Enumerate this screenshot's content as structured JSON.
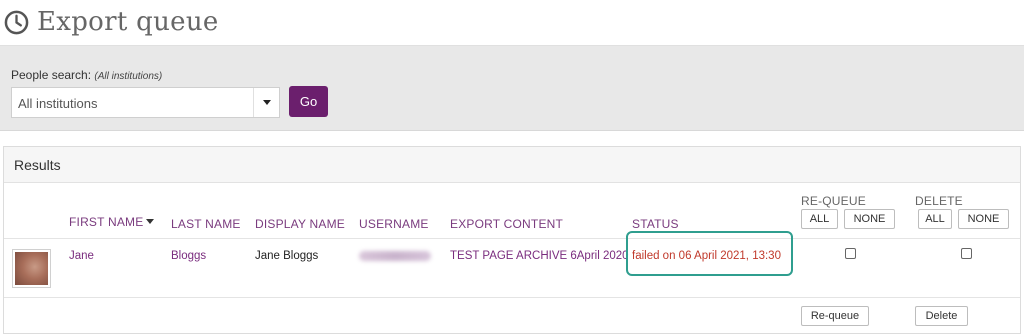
{
  "page": {
    "title": "Export queue"
  },
  "search": {
    "label": "People search:",
    "hint": "(All institutions)",
    "selected": "All institutions",
    "go_label": "Go"
  },
  "results": {
    "header": "Results",
    "columns": {
      "first_name": "FIRST NAME",
      "last_name": "LAST NAME",
      "display_name": "DISPLAY NAME",
      "username": "USERNAME",
      "export_content": "EXPORT CONTENT",
      "status": "STATUS",
      "requeue": "RE-QUEUE",
      "delete": "DELETE"
    },
    "select_buttons": {
      "all": "ALL",
      "none": "NONE"
    },
    "rows": [
      {
        "first_name": "Jane",
        "last_name": "Bloggs",
        "display_name": "Jane Bloggs",
        "export_content": "TEST PAGE ARCHIVE 6April 2020",
        "status": "failed on 06 April 2021, 13:30"
      }
    ],
    "actions": {
      "requeue": "Re-queue",
      "delete": "Delete"
    }
  },
  "colors": {
    "accent": "#6b1f6d",
    "link": "#7a2c7e",
    "status_failed": "#c0392b",
    "highlight": "#2f9e8f"
  },
  "icons": {
    "title": "clock-icon",
    "sort": "sort-desc-icon",
    "select": "caret-down-icon"
  }
}
